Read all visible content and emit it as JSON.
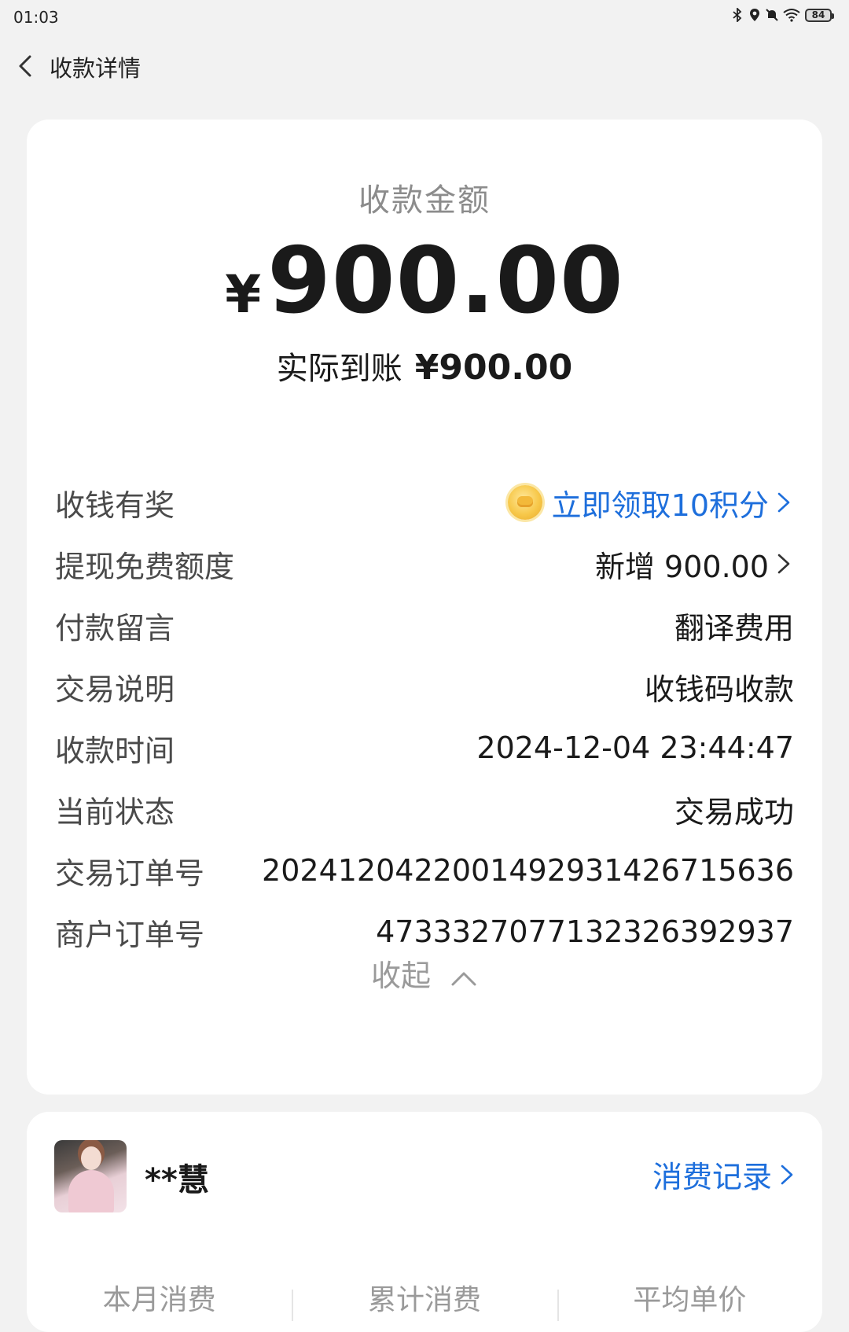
{
  "status_bar": {
    "time": "01:03",
    "battery": "84",
    "icons": [
      "bluetooth-icon",
      "location-icon",
      "mute-icon",
      "wifi-icon",
      "battery-icon"
    ]
  },
  "nav": {
    "title": "收款详情"
  },
  "summary": {
    "amount_label": "收款金额",
    "currency": "¥",
    "amount": "900.00",
    "actual_label": "实际到账",
    "actual_amount": "¥900.00"
  },
  "details": {
    "reward_label": "收钱有奖",
    "reward_value": "立即领取10积分",
    "quota_label": "提现免费额度",
    "quota_value": "新增 900.00",
    "message_label": "付款留言",
    "message_value": "翻译费用",
    "desc_label": "交易说明",
    "desc_value": "收钱码收款",
    "time_label": "收款时间",
    "time_value": "2024-12-04 23:44:47",
    "status_label": "当前状态",
    "status_value": "交易成功",
    "order_label": "交易订单号",
    "order_value": "2024120422001492931426715636",
    "merchant_label": "商户订单号",
    "merchant_value": "4733327077132326392937"
  },
  "collapse_label": "收起",
  "payer": {
    "name": "**慧",
    "records_label": "消费记录",
    "stats": [
      "本月消费",
      "累计消费",
      "平均单价"
    ]
  },
  "colors": {
    "link": "#1e6fdc",
    "background": "#f2f2f2",
    "card": "#ffffff"
  }
}
